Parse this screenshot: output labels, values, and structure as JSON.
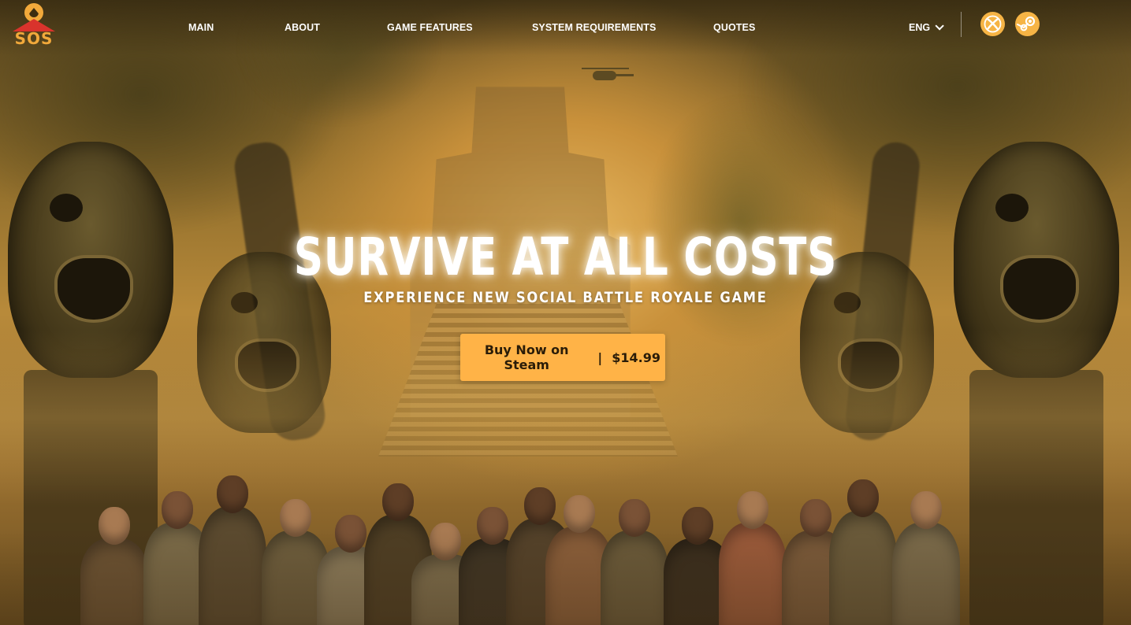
{
  "brand": {
    "logo_text": "SOS"
  },
  "nav": {
    "items": [
      {
        "label": "MAIN"
      },
      {
        "label": "ABOUT"
      },
      {
        "label": "GAME FEATURES"
      },
      {
        "label": "SYSTEM REQUIREMENTS"
      },
      {
        "label": "QUOTES"
      }
    ],
    "language": "ENG",
    "platforms": [
      {
        "icon": "xbox-icon"
      },
      {
        "icon": "steam-icon"
      }
    ]
  },
  "hero": {
    "title": "SURVIVE AT ALL COSTS",
    "subtitle": "EXPERIENCE NEW SOCIAL BATTLE ROYALE GAME",
    "cta": {
      "label": "Buy Now on Steam",
      "separator": "|",
      "price": "$14.99"
    }
  },
  "colors": {
    "accent": "#ffb347",
    "logo_orange": "#f2a93b",
    "logo_red": "#d9332c",
    "text": "#ffffff"
  }
}
